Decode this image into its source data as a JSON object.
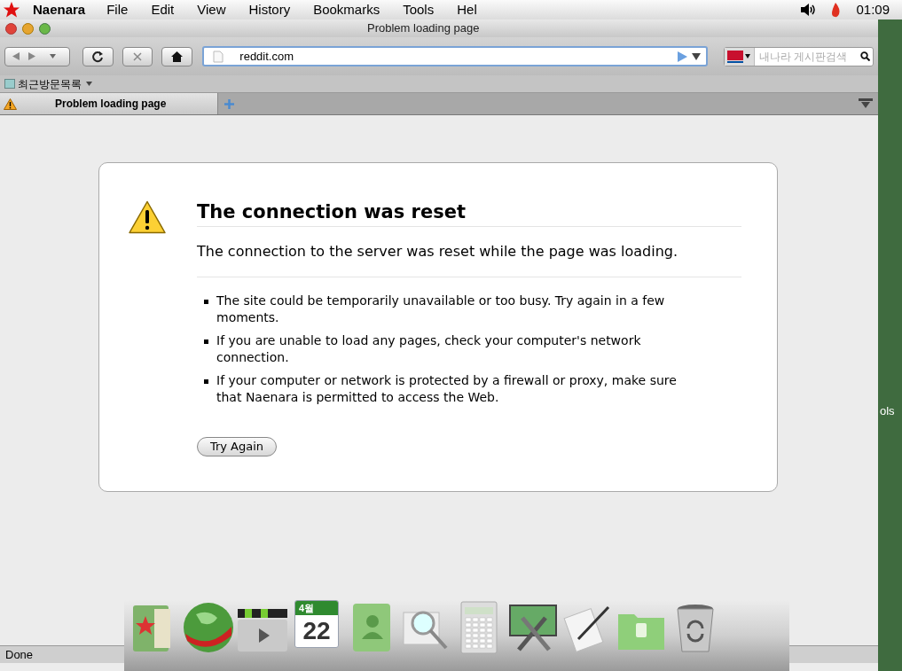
{
  "menubar": {
    "app_name": "Naenara",
    "menus": [
      "File",
      "Edit",
      "View",
      "History",
      "Bookmarks",
      "Tools",
      "Hel"
    ],
    "clock": "01:09"
  },
  "window": {
    "title": "Problem loading page"
  },
  "toolbar": {
    "url": "reddit.com",
    "search": {
      "placeholder": "내나라 게시판검색"
    }
  },
  "bookmarks": [
    "최근방문목록"
  ],
  "tabs": [
    {
      "label": "Problem loading page",
      "selected": true
    }
  ],
  "error": {
    "title": "The connection was reset",
    "subtitle": "The connection to the server was reset while the page was loading.",
    "bullets": [
      "The site could be temporarily unavailable or too busy. Try again in a few moments.",
      "If you are unable to load any pages, check your computer's network connection.",
      "If your computer or network is protected by a firewall or proxy, make sure that Naenara is permitted to access the Web."
    ],
    "button": "Try Again"
  },
  "status_bar": "Done",
  "desktop_label": "ols",
  "dock": [
    {
      "kind": "folder-star"
    },
    {
      "kind": "globe"
    },
    {
      "kind": "clapper"
    },
    {
      "kind": "calendar",
      "month": "4월",
      "day": "22"
    },
    {
      "kind": "contacts"
    },
    {
      "kind": "magnifier"
    },
    {
      "kind": "calculator"
    },
    {
      "kind": "tools"
    },
    {
      "kind": "pen"
    },
    {
      "kind": "folder"
    },
    {
      "kind": "trash"
    }
  ]
}
